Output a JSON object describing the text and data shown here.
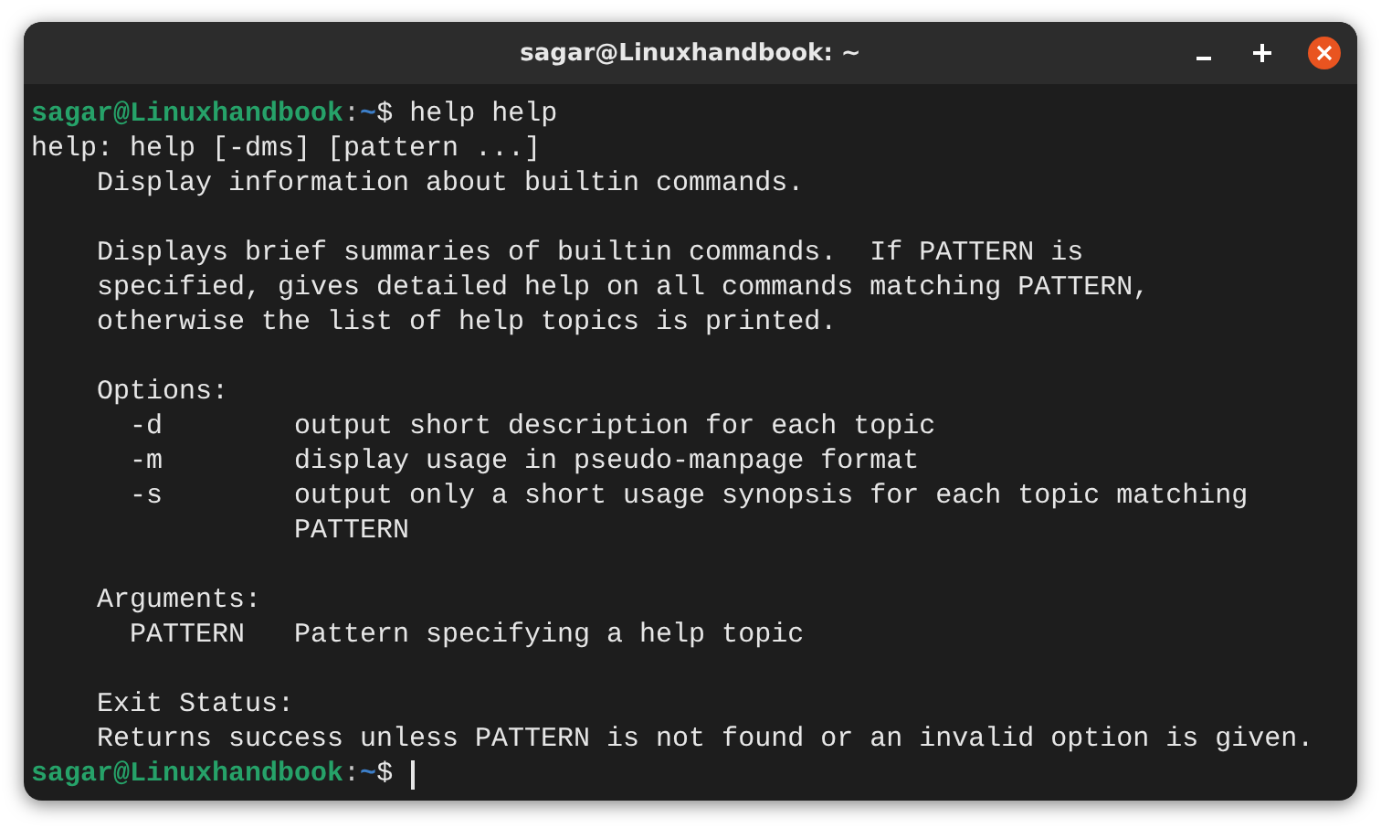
{
  "window": {
    "title": "sagar@Linuxhandbook: ~"
  },
  "terminal": {
    "lines": [
      {
        "kind": "prompt",
        "user": "sagar@Linuxhandbook",
        "separator": ":",
        "path": "~",
        "symbol": "$",
        "command": "help help"
      },
      {
        "kind": "output",
        "text": "help: help [-dms] [pattern ...]"
      },
      {
        "kind": "output",
        "text": "    Display information about builtin commands."
      },
      {
        "kind": "blank"
      },
      {
        "kind": "output",
        "text": "    Displays brief summaries of builtin commands.  If PATTERN is"
      },
      {
        "kind": "output",
        "text": "    specified, gives detailed help on all commands matching PATTERN,"
      },
      {
        "kind": "output",
        "text": "    otherwise the list of help topics is printed."
      },
      {
        "kind": "blank"
      },
      {
        "kind": "output",
        "text": "    Options:"
      },
      {
        "kind": "output",
        "text": "      -d        output short description for each topic"
      },
      {
        "kind": "output",
        "text": "      -m        display usage in pseudo-manpage format"
      },
      {
        "kind": "output",
        "text": "      -s        output only a short usage synopsis for each topic matching"
      },
      {
        "kind": "output",
        "text": "                PATTERN"
      },
      {
        "kind": "blank"
      },
      {
        "kind": "output",
        "text": "    Arguments:"
      },
      {
        "kind": "output",
        "text": "      PATTERN   Pattern specifying a help topic"
      },
      {
        "kind": "blank"
      },
      {
        "kind": "output",
        "text": "    Exit Status:"
      },
      {
        "kind": "output",
        "text": "    Returns success unless PATTERN is not found or an invalid option is given."
      },
      {
        "kind": "prompt",
        "user": "sagar@Linuxhandbook",
        "separator": ":",
        "path": "~",
        "symbol": "$",
        "cursor": true
      }
    ]
  }
}
